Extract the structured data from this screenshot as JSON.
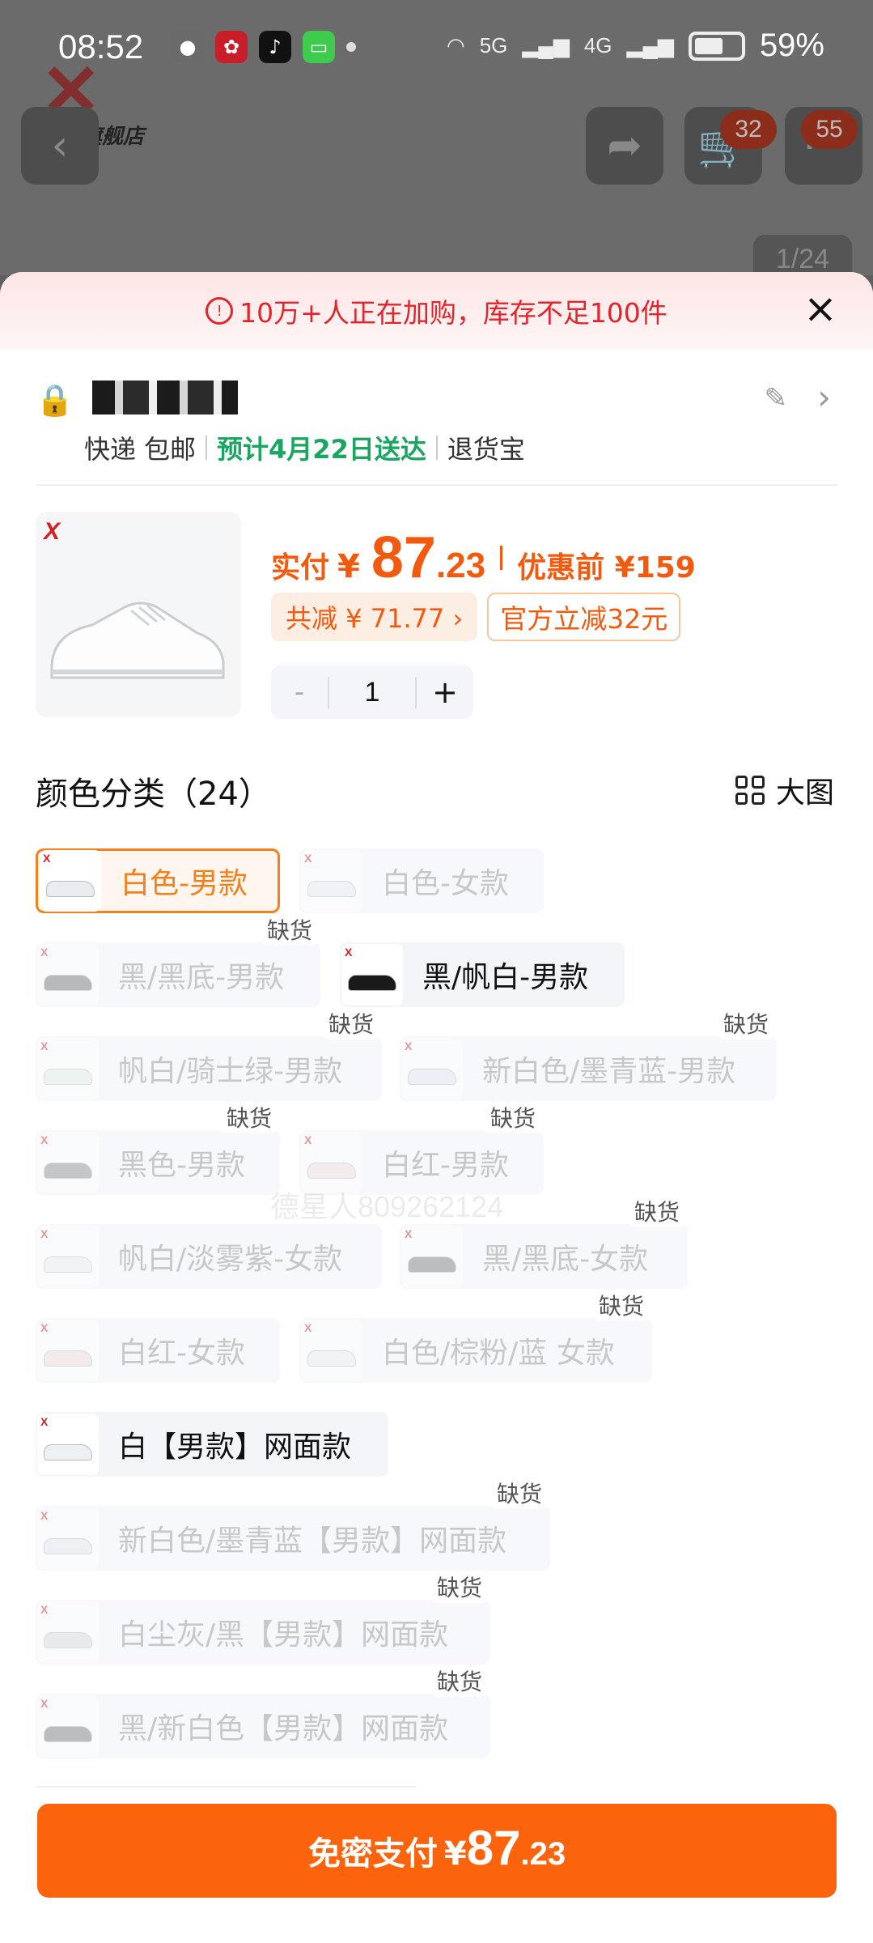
{
  "status_bar": {
    "time": "08:52",
    "network_1": "5G",
    "network_2": "4G",
    "battery": "59%",
    "apps": [
      "wechat-icon",
      "red-app-icon",
      "tiktok-icon",
      "messages-icon"
    ]
  },
  "header": {
    "store_name": "官方旗舰店",
    "cart_badge": "32",
    "message_badge": "55",
    "image_counter": "1/24"
  },
  "banner": {
    "text": "10万+人正在加购，库存不足100件",
    "color": "#e0262c"
  },
  "address": {
    "courier": "快递",
    "shipping": "包邮",
    "delivery": "预计4月22日送达",
    "return_service": "退货宝"
  },
  "product": {
    "price_label": "实付",
    "currency": "¥",
    "price_int": "87",
    "price_dec": ".23",
    "original_label": "优惠前 ¥159",
    "total_discount": "共减 ¥ 71.77 ›",
    "official_discount": "官方立减32元",
    "quantity": "1",
    "minus": "-",
    "plus": "+",
    "brand_mark": "X"
  },
  "variants_section": {
    "title": "颜色分类（24）",
    "big_view_label": "大图",
    "out_of_stock_label": "缺货",
    "items": [
      {
        "label": "白色-男款",
        "state": "selected",
        "out_of_stock": false
      },
      {
        "label": "白色-女款",
        "state": "disabled",
        "out_of_stock": false
      },
      {
        "label": "黑/黑底-男款",
        "state": "disabled",
        "out_of_stock": true
      },
      {
        "label": "黑/帆白-男款",
        "state": "available",
        "out_of_stock": false
      },
      {
        "label": "帆白/骑士绿-男款",
        "state": "disabled",
        "out_of_stock": true
      },
      {
        "label": "新白色/墨青蓝-男款",
        "state": "disabled",
        "out_of_stock": true
      },
      {
        "label": "黑色-男款",
        "state": "disabled",
        "out_of_stock": true
      },
      {
        "label": "白红-男款",
        "state": "disabled",
        "out_of_stock": true
      },
      {
        "label": "帆白/淡雾紫-女款",
        "state": "disabled",
        "out_of_stock": false
      },
      {
        "label": "黑/黑底-女款",
        "state": "disabled",
        "out_of_stock": true
      },
      {
        "label": "白红-女款",
        "state": "disabled",
        "out_of_stock": false
      },
      {
        "label": "白色/棕粉/蓝 女款",
        "state": "disabled",
        "out_of_stock": true
      },
      {
        "label": "白【男款】网面款",
        "state": "available",
        "out_of_stock": false
      },
      {
        "label": "新白色/墨青蓝【男款】网面款",
        "state": "disabled",
        "out_of_stock": true
      },
      {
        "label": "白尘灰/黑【男款】网面款",
        "state": "disabled",
        "out_of_stock": true
      },
      {
        "label": "黑/新白色【男款】网面款",
        "state": "disabled",
        "out_of_stock": true
      }
    ]
  },
  "watermark": "德星人809262124",
  "pay": {
    "label": "免密支付",
    "currency": "¥",
    "price_int": "87",
    "price_dec": ".23",
    "color": "#fb640d"
  }
}
